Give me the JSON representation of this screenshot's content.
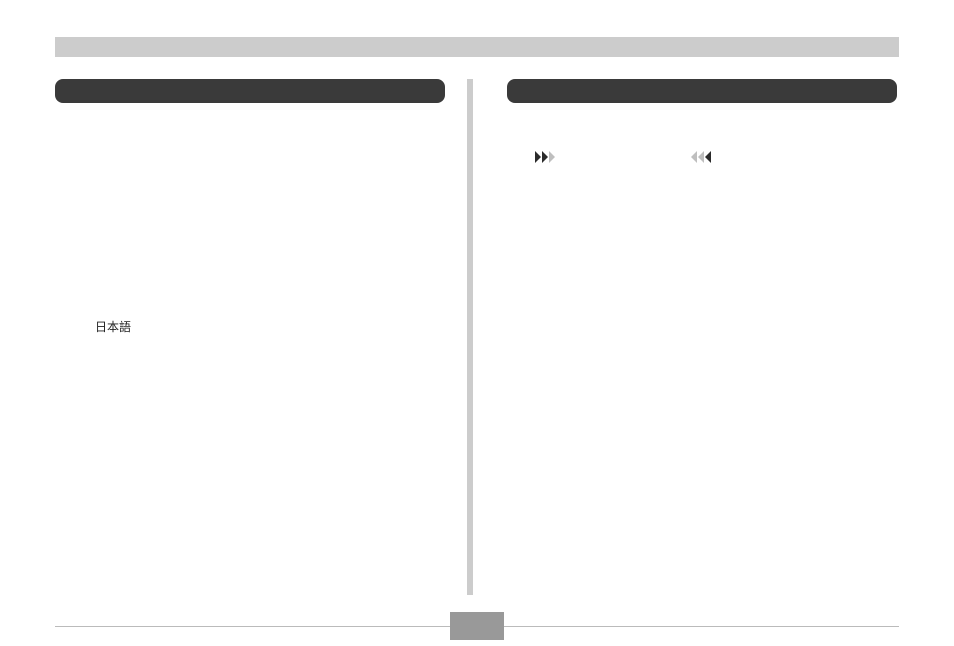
{
  "top_bar": {},
  "left_section": {
    "header": "",
    "japanese_label": "日本語"
  },
  "right_section": {
    "header": "",
    "icons": {
      "forward": "forward-icon",
      "backward": "backward-icon"
    }
  }
}
